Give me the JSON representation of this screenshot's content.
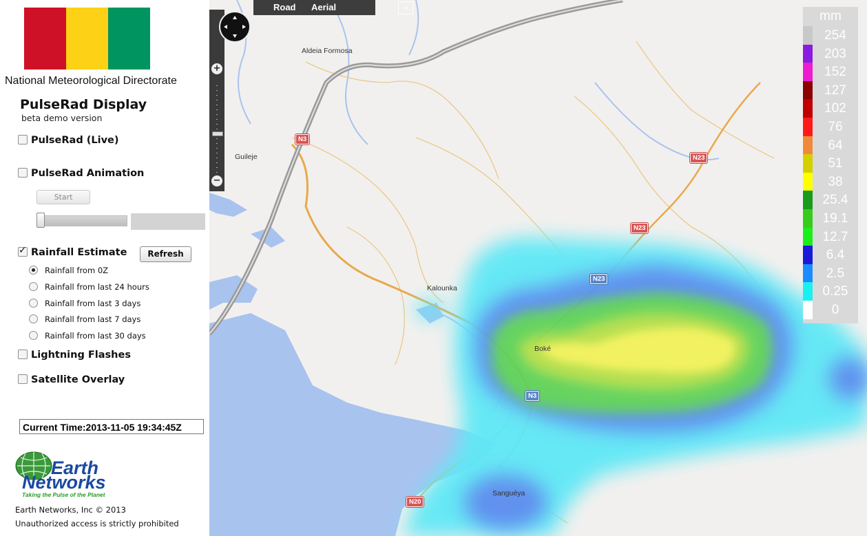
{
  "org_name": "National Meteorological Directorate",
  "flag_colors": [
    "#ce1126",
    "#fcd116",
    "#009460"
  ],
  "app": {
    "title": "PulseRad Display",
    "subtitle": "beta demo version"
  },
  "options": {
    "pulserad_live": {
      "label": "PulseRad (Live)",
      "checked": false
    },
    "pulserad_animation": {
      "label": "PulseRad Animation",
      "checked": false
    },
    "start_button": "Start",
    "rainfall_estimate": {
      "label": "Rainfall Estimate",
      "checked": true
    },
    "refresh_button": "Refresh",
    "rainfall_ranges": [
      {
        "label": "Rainfall from 0Z",
        "selected": true
      },
      {
        "label": "Rainfall from last 24 hours",
        "selected": false
      },
      {
        "label": "Rainfall from last 3 days",
        "selected": false
      },
      {
        "label": "Rainfall from last 7 days",
        "selected": false
      },
      {
        "label": "Rainfall from last 30 days",
        "selected": false
      }
    ],
    "lightning": {
      "label": "Lightning Flashes",
      "checked": false
    },
    "satellite": {
      "label": "Satellite Overlay",
      "checked": false
    }
  },
  "current_time": "Current Time:2013-11-05 19:34:45Z",
  "logo": {
    "line1": "Earth",
    "line2": "Networks",
    "tagline": "Taking the Pulse of the Planet"
  },
  "footer": {
    "copyright": "Earth Networks, Inc © 2013",
    "notice": "Unauthorized access is strictly prohibited"
  },
  "map": {
    "map_types": [
      "Road",
      "Aerial"
    ],
    "collapse_icon": "double-chevron-left-icon",
    "places": [
      "Aldeia Formosa",
      "Guileje",
      "Kalounka",
      "Boké",
      "Sanguéya"
    ],
    "road_shields": [
      "N3",
      "N23",
      "N23",
      "N23",
      "N3",
      "N20"
    ]
  },
  "legend": {
    "unit": "mm",
    "items": [
      {
        "value": "254",
        "color": "#c8c8c8"
      },
      {
        "value": "203",
        "color": "#8a1be0"
      },
      {
        "value": "152",
        "color": "#ee1bd0"
      },
      {
        "value": "127",
        "color": "#8b0000"
      },
      {
        "value": "102",
        "color": "#c00000"
      },
      {
        "value": "76",
        "color": "#ff1a1a"
      },
      {
        "value": "64",
        "color": "#f08a3a"
      },
      {
        "value": "51",
        "color": "#d4d000"
      },
      {
        "value": "38",
        "color": "#ffff00"
      },
      {
        "value": "25.4",
        "color": "#1a9a1a"
      },
      {
        "value": "19.1",
        "color": "#36cc1a"
      },
      {
        "value": "12.7",
        "color": "#1aef1a"
      },
      {
        "value": "6.4",
        "color": "#1a1ad8"
      },
      {
        "value": "2.5",
        "color": "#1a8cff"
      },
      {
        "value": "0.25",
        "color": "#1af0f0"
      },
      {
        "value": "0",
        "color": "#ffffff"
      }
    ]
  }
}
